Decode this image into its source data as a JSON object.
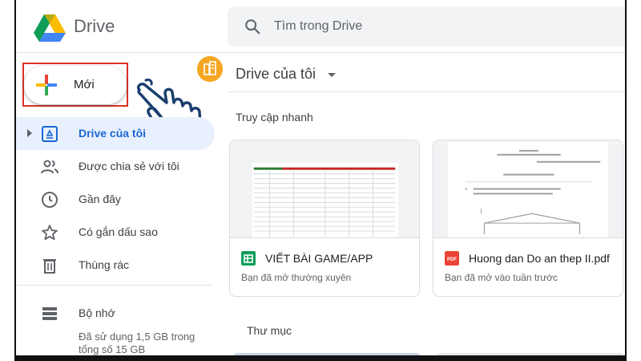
{
  "header": {
    "brand": "Drive",
    "search_placeholder": "Tìm trong Drive"
  },
  "new_button": {
    "label": "Mới"
  },
  "sidebar": {
    "items": [
      {
        "label": "Drive của tôi",
        "icon": "my-drive-icon",
        "active": true
      },
      {
        "label": "Được chia sẻ với tôi",
        "icon": "shared-people-icon"
      },
      {
        "label": "Gần đây",
        "icon": "clock-icon"
      },
      {
        "label": "Có gắn dấu sao",
        "icon": "star-icon"
      },
      {
        "label": "Thùng rác",
        "icon": "trash-icon"
      }
    ],
    "storage": {
      "label": "Bộ nhớ",
      "icon": "storage-icon",
      "usage": "Đã sử dụng 1,5 GB trong tổng số 15 GB"
    }
  },
  "main": {
    "title": "Drive của tôi",
    "quick_access_title": "Truy cập nhanh",
    "files": [
      {
        "name": "VIẾT BÀI GAME/APP",
        "meta": "Bạn đã mở thường xuyên",
        "icon": "sheets-icon",
        "color": "#0f9d58"
      },
      {
        "name": "Huong dan Do an thep II.pdf",
        "meta": "Bạn đã mở vào tuần trước",
        "icon": "pdf-icon",
        "color": "#ea4335"
      }
    ],
    "folders_title": "Thư mục"
  },
  "colors": {
    "accent": "#1967d2",
    "highlight_outline": "#d93025"
  }
}
